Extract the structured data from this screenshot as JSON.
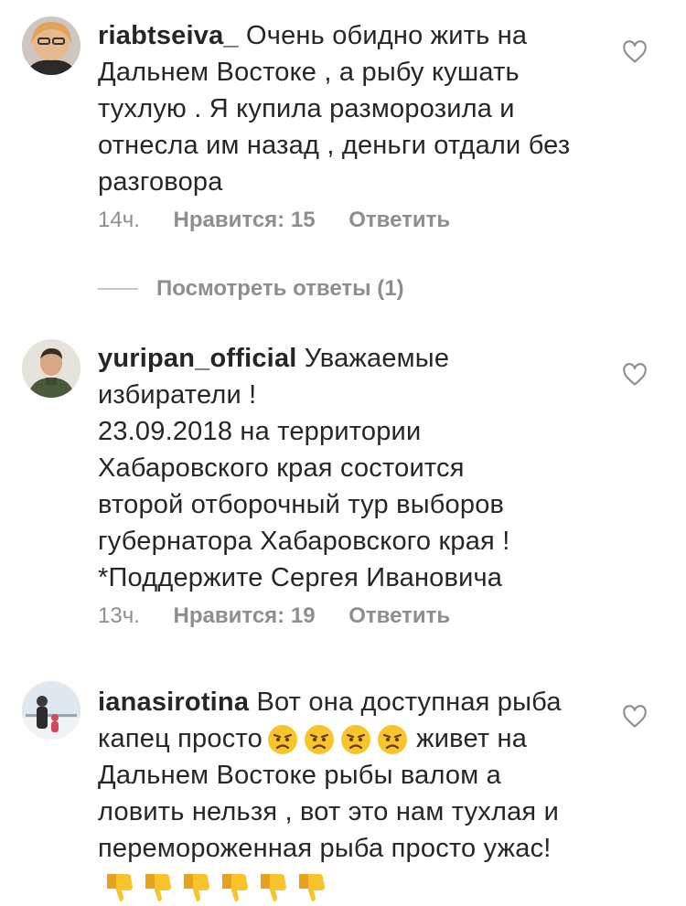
{
  "comments": [
    {
      "username": "riabtseiva_",
      "text": "Очень обидно  жить на Дальнем Востоке , а рыбу кушать тухлую . Я купила  разморозила и отнесла им назад , деньги отдали без разговора",
      "time": "14ч.",
      "likes": "Нравится: 15",
      "reply": "Ответить"
    },
    {
      "username": "yuripan_official",
      "text": "Уважаемые избиратели !",
      "text_lines": [
        "23.09.2018 на территории",
        "Хабаровского края состоится",
        "второй отборочный тур выборов",
        "губернатора Хабаровского края !",
        "*Поддержите Сергея Ивановича"
      ],
      "time": "13ч.",
      "likes": "Нравится: 19",
      "reply": "Ответить"
    },
    {
      "username": "ianasirotina",
      "text": "Вот она доступная рыба капец просто",
      "text_2": "живет на Дальнем Востоке рыбы валом а ловить нельзя , вот это нам тухлая и перемороженная рыба просто ужас!"
    }
  ],
  "view_replies": "Посмотреть ответы (1)",
  "icons": {
    "heart": "heart-outline-icon",
    "angry": "angry-face-emoji",
    "thumbs_down": "thumbs-down-emoji"
  },
  "colors": {
    "text": "#262626",
    "meta": "#8e8e8e",
    "emoji": "#f7c52b"
  }
}
